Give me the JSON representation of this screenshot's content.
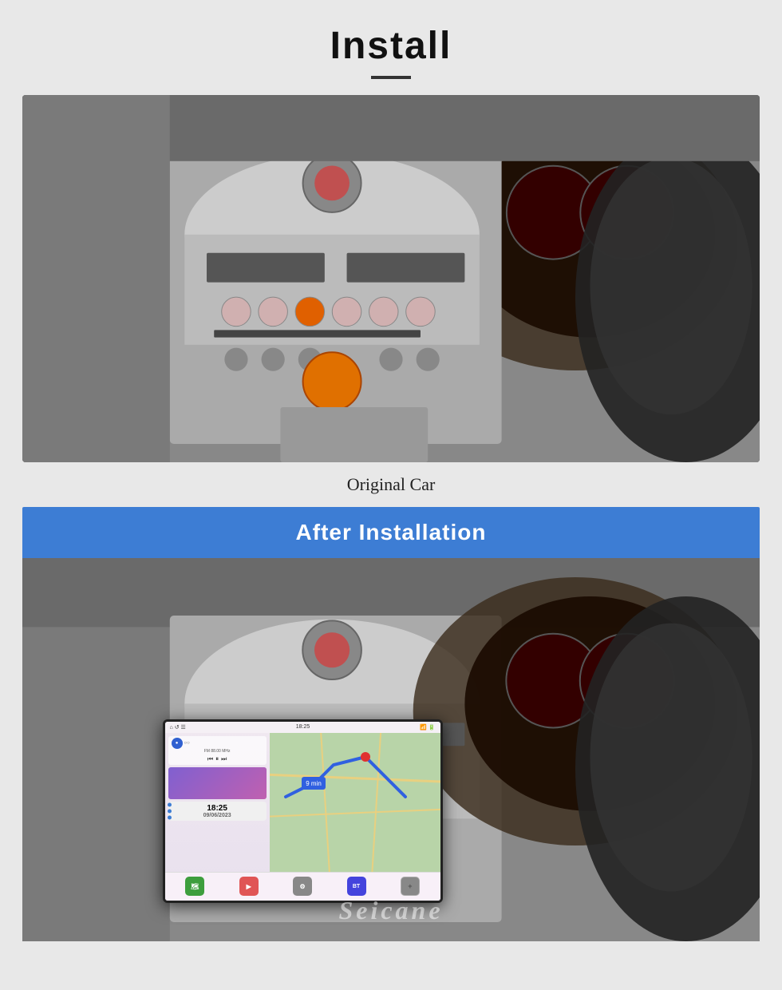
{
  "header": {
    "title": "Install",
    "divider": true
  },
  "original_car": {
    "caption": "Original Car"
  },
  "after_installation": {
    "banner_text": "After  Installation"
  },
  "head_unit_screen": {
    "status_bar": {
      "time": "18:25",
      "icons": [
        "wifi",
        "signal",
        "battery"
      ]
    },
    "radio": {
      "text": "FM 88.00 MHz"
    },
    "clock": {
      "time": "18:25",
      "date": "09/06/2023"
    },
    "app_labels": [
      "Maps",
      "Video",
      "Settings",
      "Bluedio",
      "ADD"
    ]
  },
  "watermark": {
    "text": "Seicane"
  }
}
